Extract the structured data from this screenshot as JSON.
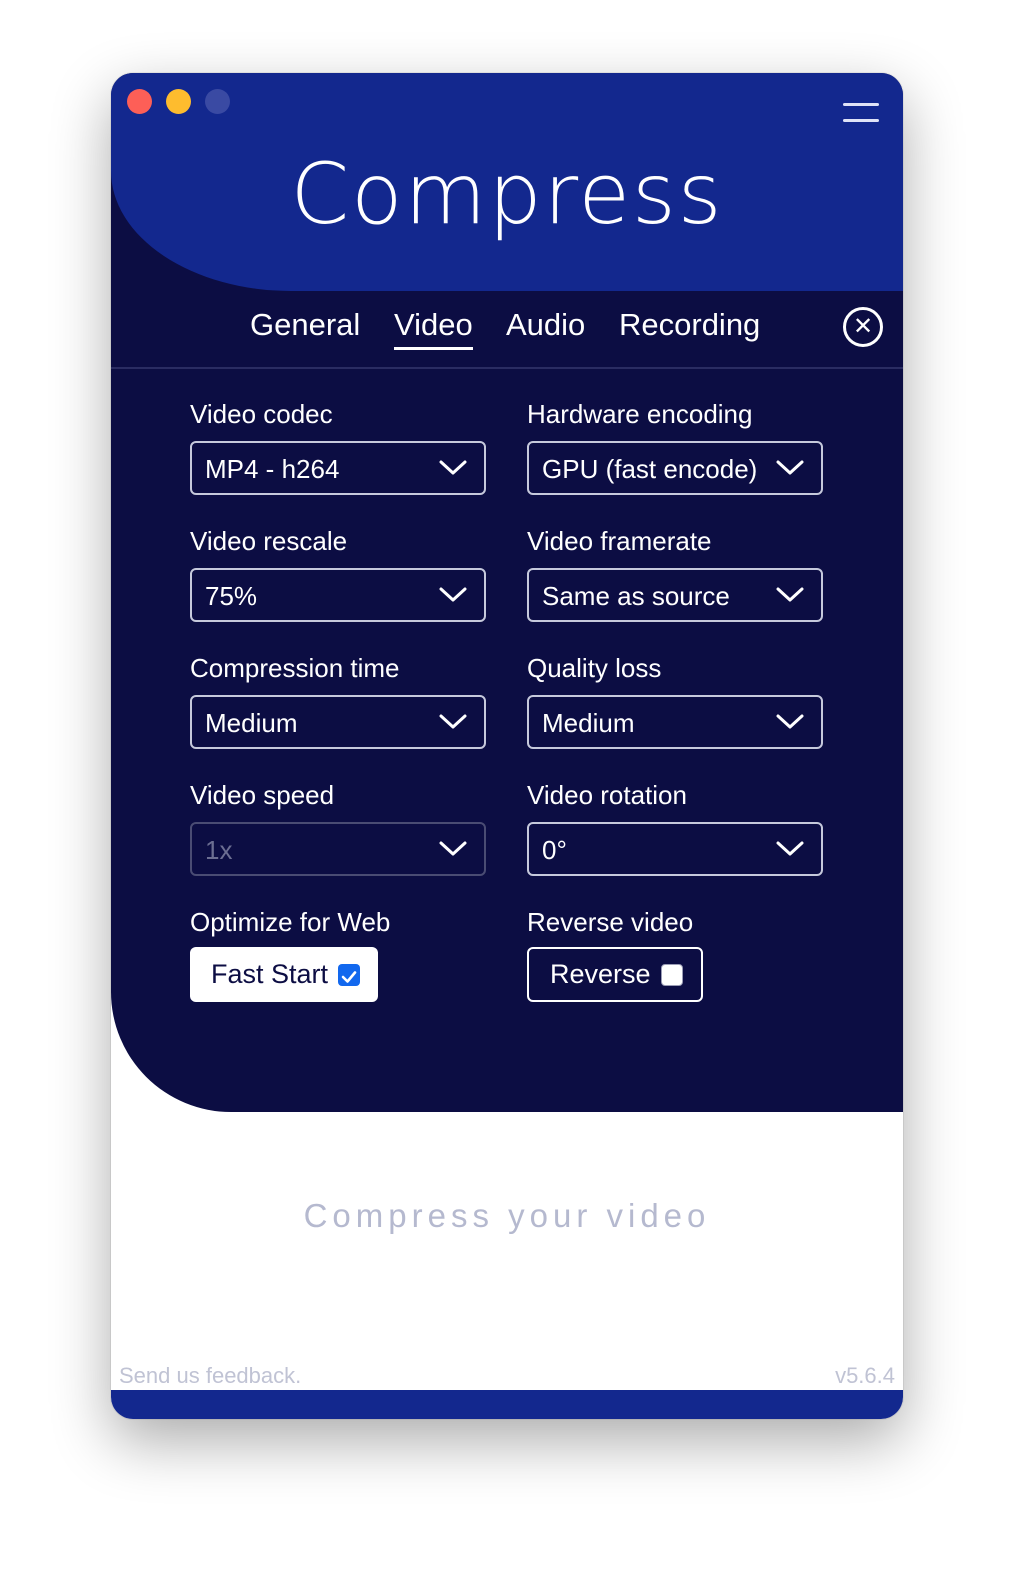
{
  "window": {
    "traffic_lights": {
      "close_color": "#fd5f57",
      "minimize_color": "#febc2e",
      "zoom_color": "#3a4aa3"
    },
    "menu_icon": "hamburger-icon"
  },
  "header": {
    "logo": "Compress"
  },
  "tabs": [
    {
      "label": "General",
      "active": false
    },
    {
      "label": "Video",
      "active": true
    },
    {
      "label": "Audio",
      "active": false
    },
    {
      "label": "Recording",
      "active": false
    }
  ],
  "close_icon": "circle-x-icon",
  "fields": {
    "video_codec": {
      "label": "Video codec",
      "value": "MP4 - h264"
    },
    "hardware_encoding": {
      "label": "Hardware encoding",
      "value": "GPU (fast encode)"
    },
    "video_rescale": {
      "label": "Video rescale",
      "value": "75%"
    },
    "video_framerate": {
      "label": "Video framerate",
      "value": "Same as source"
    },
    "compression_time": {
      "label": "Compression time",
      "value": "Medium"
    },
    "quality_loss": {
      "label": "Quality loss",
      "value": "Medium"
    },
    "video_speed": {
      "label": "Video speed",
      "value": "1x",
      "disabled": true
    },
    "video_rotation": {
      "label": "Video rotation",
      "value": "0°"
    },
    "optimize_web": {
      "label": "Optimize for Web",
      "button": "Fast Start",
      "checked": true
    },
    "reverse_video": {
      "label": "Reverse video",
      "button": "Reverse",
      "checked": false
    }
  },
  "drop_area": {
    "text": "Compress your video"
  },
  "footer": {
    "feedback": "Send us feedback.",
    "version": "v5.6.4"
  },
  "colors": {
    "header_blue": "#13288e",
    "panel_navy": "#0c0d43",
    "checkbox_blue": "#1268ee"
  }
}
